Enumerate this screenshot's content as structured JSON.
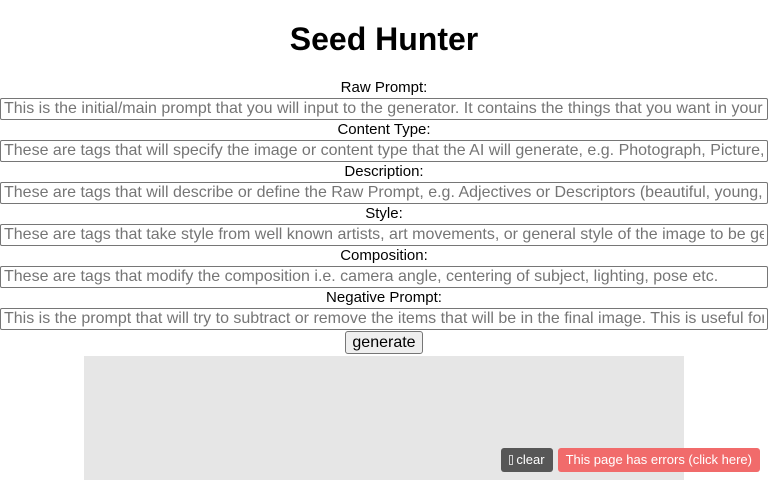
{
  "header": {
    "title": "Seed Hunter"
  },
  "form": {
    "fields": [
      {
        "label": "Raw Prompt:",
        "placeholder": "This is the initial/main prompt that you will input to the generator. It contains the things that you want in your image"
      },
      {
        "label": "Content Type:",
        "placeholder": "These are tags that will specify the image or content type that the AI will generate, e.g. Photograph, Picture, Painting"
      },
      {
        "label": "Description:",
        "placeholder": "These are tags that will describe or define the Raw Prompt, e.g. Adjectives or Descriptors (beautiful, young, old)"
      },
      {
        "label": "Style:",
        "placeholder": "These are tags that take style from well known artists, art movements, or general style of the image to be generated"
      },
      {
        "label": "Composition:",
        "placeholder": "These are tags that modify the composition i.e. camera angle, centering of subject, lighting, pose etc."
      },
      {
        "label": "Negative Prompt:",
        "placeholder": "This is the prompt that will try to subtract or remove the items that will be in the final image. This is useful for"
      }
    ],
    "generate_label": "generate"
  },
  "console": {
    "clear_label": "clear",
    "clear_icon": "clear-icon",
    "errors_label": "This page has errors (click here)",
    "errors_color": "#f16b6b"
  }
}
